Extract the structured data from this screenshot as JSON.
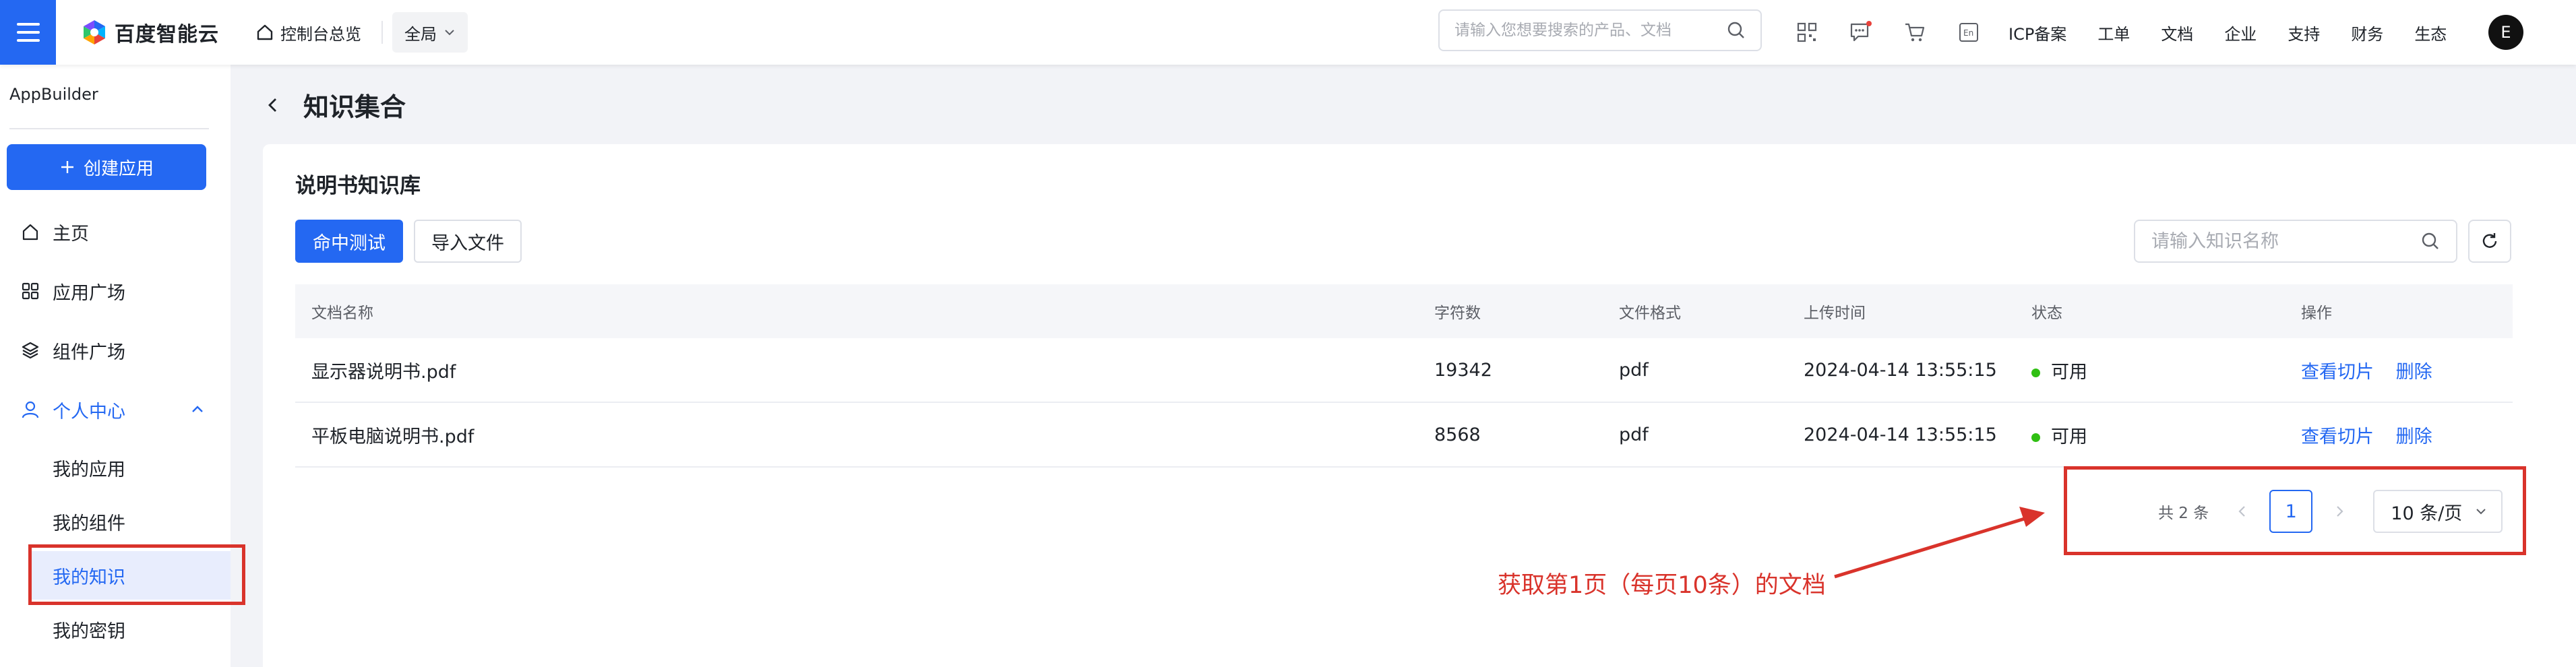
{
  "topbar": {
    "brand": "百度智能云",
    "console_label": "控制台总览",
    "region_label": "全局",
    "search_placeholder": "请输入您想要搜索的产品、文档",
    "links": [
      "ICP备案",
      "工单",
      "文档",
      "企业",
      "支持",
      "财务",
      "生态"
    ],
    "avatar_letter": "E",
    "icons": [
      "qrcode-icon",
      "message-icon",
      "cart-icon",
      "language-icon"
    ]
  },
  "sidebar": {
    "title": "AppBuilder",
    "create_label": "创建应用",
    "items": [
      {
        "label": "主页",
        "icon": "home-icon"
      },
      {
        "label": "应用广场",
        "icon": "apps-icon"
      },
      {
        "label": "组件广场",
        "icon": "layers-icon"
      },
      {
        "label": "个人中心",
        "icon": "user-icon"
      }
    ],
    "sub_items": [
      {
        "label": "我的应用"
      },
      {
        "label": "我的组件"
      },
      {
        "label": "我的知识"
      },
      {
        "label": "我的密钥"
      }
    ]
  },
  "page": {
    "title": "知识集合"
  },
  "card": {
    "title": "说明书知识库",
    "hit_test_label": "命中测试",
    "import_label": "导入文件",
    "search_placeholder": "请输入知识名称"
  },
  "table": {
    "headers": [
      "文档名称",
      "字符数",
      "文件格式",
      "上传时间",
      "状态",
      "操作"
    ],
    "rows": [
      {
        "name": "显示器说明书.pdf",
        "chars": "19342",
        "format": "pdf",
        "uploaded": "2024-04-14 13:55:15",
        "status": "可用",
        "action_view": "查看切片",
        "action_delete": "删除"
      },
      {
        "name": "平板电脑说明书.pdf",
        "chars": "8568",
        "format": "pdf",
        "uploaded": "2024-04-14 13:55:15",
        "status": "可用",
        "action_view": "查看切片",
        "action_delete": "删除"
      }
    ]
  },
  "pagination": {
    "total": "共 2 条",
    "current_page": "1",
    "page_size": "10 条/页"
  },
  "annotation": {
    "text": "获取第1页（每页10条）的文档",
    "color": "#d9332b"
  },
  "colors": {
    "accent": "#2468f2",
    "status_ok": "#30bf13"
  }
}
